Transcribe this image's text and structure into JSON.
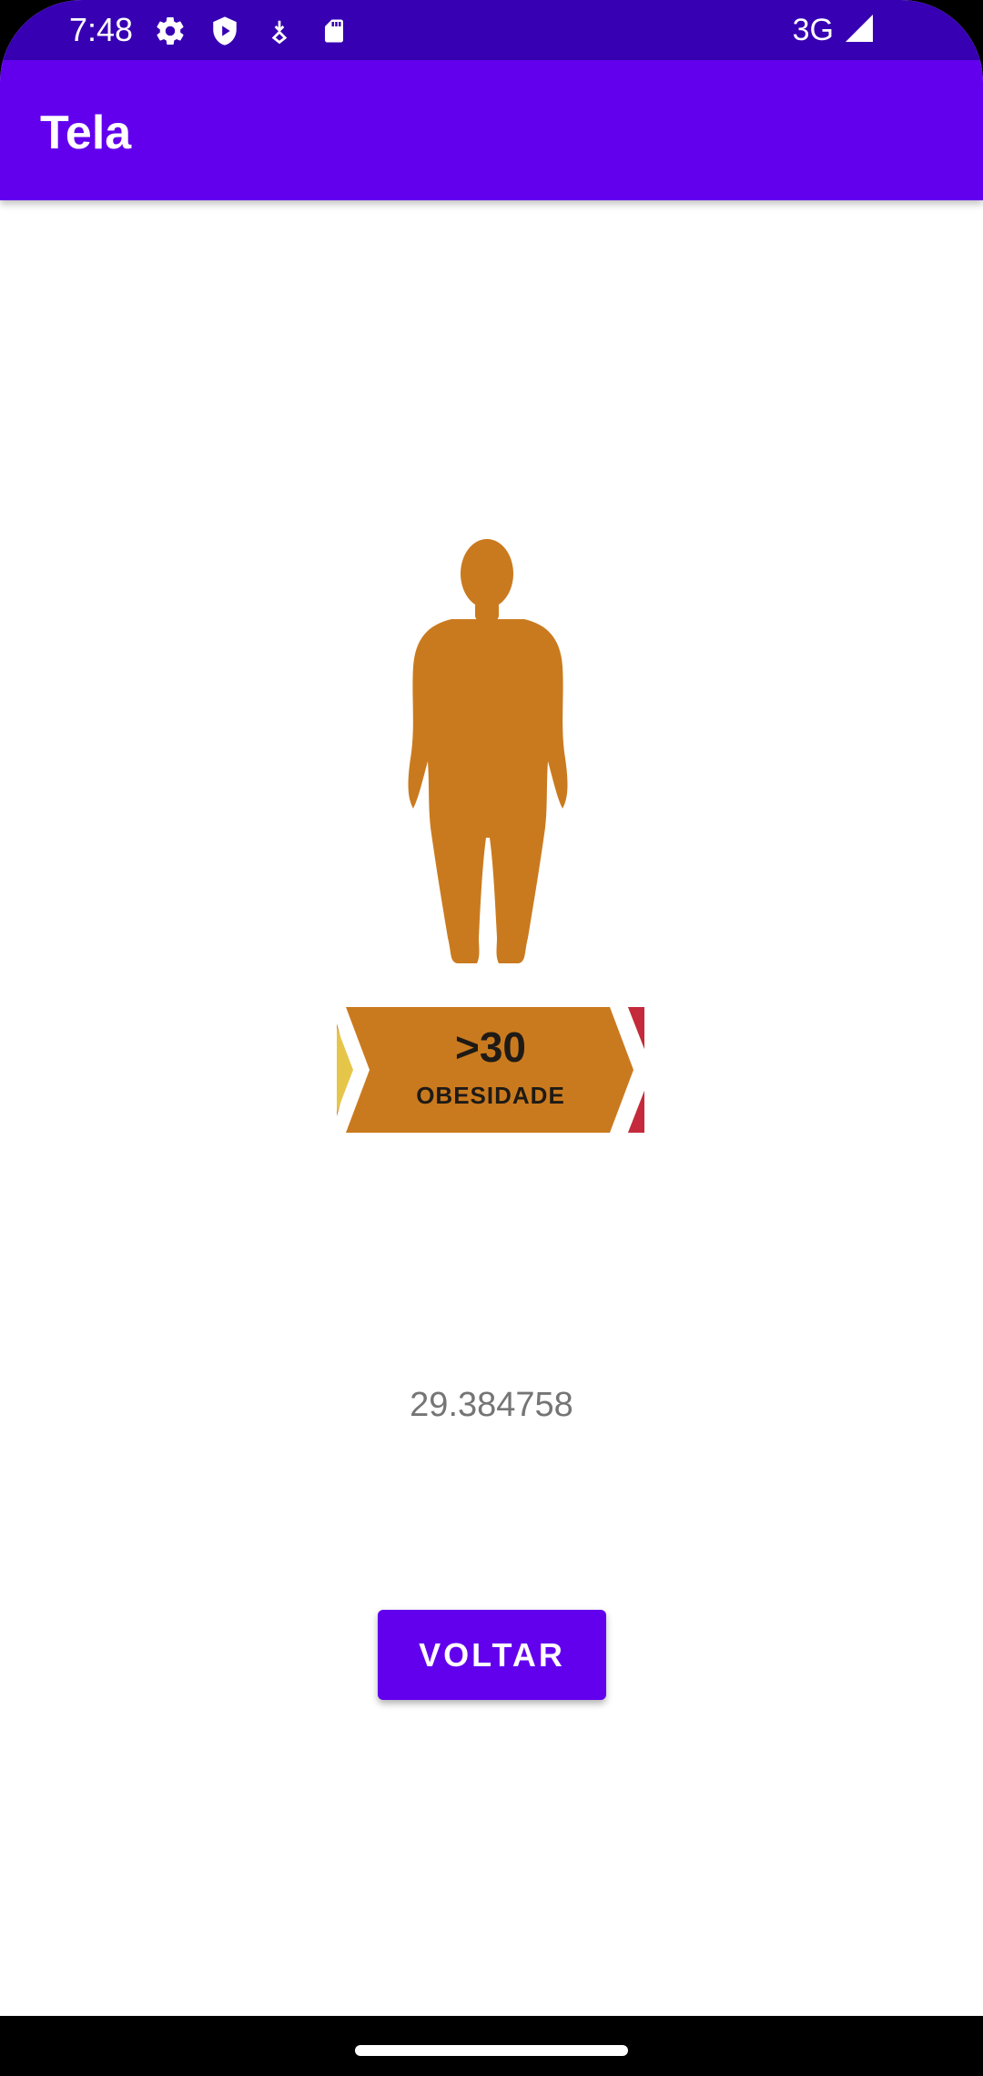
{
  "status_bar": {
    "time": "7:48",
    "network": "3G",
    "icons": [
      "settings-icon",
      "play-protect-icon",
      "download-icon",
      "sd-card-icon",
      "signal-icon"
    ],
    "color": "#3700b3"
  },
  "app_bar": {
    "title": "Tela",
    "color": "#6200ee"
  },
  "result": {
    "figure": "obese-body-silhouette",
    "banner_value": ">30",
    "banner_label": "OBESIDADE",
    "banner_color": "#ca7a1e",
    "bmi_value": "29.384758"
  },
  "actions": {
    "back_label": "VOLTAR"
  }
}
